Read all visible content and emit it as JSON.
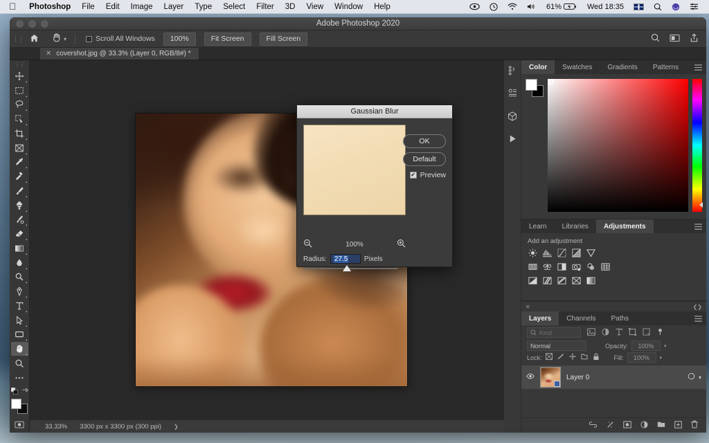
{
  "menubar": {
    "apple_icon": "apple-icon",
    "items": [
      {
        "label": "Photoshop",
        "bold": true
      },
      {
        "label": "File",
        "bold": false
      },
      {
        "label": "Edit",
        "bold": false
      },
      {
        "label": "Image",
        "bold": false
      },
      {
        "label": "Layer",
        "bold": false
      },
      {
        "label": "Type",
        "bold": false
      },
      {
        "label": "Select",
        "bold": false
      },
      {
        "label": "Filter",
        "bold": false
      },
      {
        "label": "3D",
        "bold": false
      },
      {
        "label": "View",
        "bold": false
      },
      {
        "label": "Window",
        "bold": false
      },
      {
        "label": "Help",
        "bold": false
      }
    ],
    "status": {
      "creative_cloud_icon": "creative-cloud-icon",
      "time_machine_icon": "clock-icon",
      "wifi_icon": "wifi-icon",
      "volume_icon": "speaker-icon",
      "battery_percent": "61%",
      "battery_icon": "battery-charging-icon",
      "datetime": "Wed 18:35",
      "input_flag": "uk-flag-icon",
      "spotlight_icon": "search-icon",
      "siri_icon": "siri-icon",
      "control_center_icon": "control-center-icon"
    }
  },
  "window": {
    "title": "Adobe Photoshop 2020"
  },
  "options_bar": {
    "home_icon": "home-icon",
    "tool_icon": "hand-tool-icon",
    "tool_caret": "chevron-down-icon",
    "scroll_all_windows": "Scroll All Windows",
    "buttons": [
      "100%",
      "Fit Screen",
      "Fill Screen"
    ],
    "right_icons": [
      "search-icon",
      "workspace-icon",
      "share-icon"
    ]
  },
  "document_tab": {
    "close_icon": "close-icon",
    "label": "covershot.jpg @ 33.3% (Layer 0, RGB/8#) *"
  },
  "toolbar": {
    "grip_icon": "grip-icon",
    "tools": [
      {
        "name": "move-tool",
        "active": false
      },
      {
        "name": "rectangular-marquee-tool",
        "active": false
      },
      {
        "name": "lasso-tool",
        "active": false
      },
      {
        "name": "quick-selection-tool",
        "active": false
      },
      {
        "name": "crop-tool",
        "active": false
      },
      {
        "name": "frame-tool",
        "active": false
      },
      {
        "name": "eyedropper-tool",
        "active": false
      },
      {
        "name": "spot-healing-brush-tool",
        "active": false
      },
      {
        "name": "brush-tool",
        "active": false
      },
      {
        "name": "clone-stamp-tool",
        "active": false
      },
      {
        "name": "history-brush-tool",
        "active": false
      },
      {
        "name": "eraser-tool",
        "active": false
      },
      {
        "name": "gradient-tool",
        "active": false
      },
      {
        "name": "blur-tool",
        "active": false
      },
      {
        "name": "dodge-tool",
        "active": false
      },
      {
        "name": "pen-tool",
        "active": false
      },
      {
        "name": "type-tool",
        "active": false
      },
      {
        "name": "path-selection-tool",
        "active": false
      },
      {
        "name": "rectangle-tool",
        "active": false
      },
      {
        "name": "hand-tool",
        "active": true
      },
      {
        "name": "zoom-tool",
        "active": false
      },
      {
        "name": "edit-toolbar-tool",
        "active": false
      }
    ],
    "quickmask_icon": "quick-mask-icon",
    "screenmode_icon": "screen-mode-icon"
  },
  "canvas": {
    "zoom": "33.33%",
    "dimensions": "3300 px x 3300 px (300 ppi)",
    "status_caret": "chevron-right-icon"
  },
  "icon_dock": {
    "items": [
      "history-icon",
      "actions-icon",
      "3d-icon",
      "play-icon"
    ]
  },
  "color_panel": {
    "tabs": [
      {
        "label": "Color",
        "active": true
      },
      {
        "label": "Swatches",
        "active": false
      },
      {
        "label": "Gradients",
        "active": false
      },
      {
        "label": "Patterns",
        "active": false
      }
    ],
    "menu_icon": "panel-menu-icon",
    "foreground_color": "#ffffff",
    "background_color": "#000000"
  },
  "adjustments_panel": {
    "tabs": [
      {
        "label": "Learn",
        "active": false
      },
      {
        "label": "Libraries",
        "active": false
      },
      {
        "label": "Adjustments",
        "active": true
      }
    ],
    "menu_icon": "panel-menu-icon",
    "heading": "Add an adjustment",
    "rows": [
      [
        "brightness-contrast-icon",
        "levels-icon",
        "curves-icon",
        "exposure-icon",
        "vibrance-icon"
      ],
      [
        "hue-saturation-icon",
        "color-balance-icon",
        "black-white-icon",
        "photo-filter-icon",
        "channel-mixer-icon",
        "color-lookup-icon"
      ],
      [
        "invert-icon",
        "posterize-icon",
        "threshold-icon",
        "selective-color-icon",
        "gradient-map-icon"
      ]
    ]
  },
  "layers_panel": {
    "close_icon": "close-icon",
    "collapse_icon": "collapse-icon",
    "tabs": [
      {
        "label": "Layers",
        "active": true
      },
      {
        "label": "Channels",
        "active": false
      },
      {
        "label": "Paths",
        "active": false
      }
    ],
    "menu_icon": "panel-menu-icon",
    "filter_placeholder": "Kind",
    "filter_search_icon": "search-icon",
    "filter_kinds": [
      "pixel-filter-icon",
      "adjustment-filter-icon",
      "type-filter-icon",
      "shape-filter-icon",
      "smart-object-filter-icon"
    ],
    "filter_toggle_icon": "filter-toggle-icon",
    "blend_mode": "Normal",
    "opacity_label": "Opacity:",
    "opacity_value": "100%",
    "lock_label": "Lock:",
    "lock_icons": [
      "lock-transparent-icon",
      "lock-image-icon",
      "lock-position-icon",
      "lock-artboard-icon",
      "lock-all-icon"
    ],
    "fill_label": "Fill:",
    "fill_value": "100%",
    "layers": [
      {
        "visible_icon": "eye-icon",
        "name": "Layer 0",
        "smart_object_icon": "smart-object-icon",
        "expand_icon": "chevron-down-icon"
      }
    ],
    "footer_icons": [
      "link-layers-icon",
      "layer-style-icon",
      "layer-mask-icon",
      "adjustment-layer-icon",
      "new-group-icon",
      "new-layer-icon",
      "delete-layer-icon"
    ]
  },
  "gaussian_blur_dialog": {
    "title": "Gaussian Blur",
    "ok_label": "OK",
    "default_label": "Default",
    "preview_label": "Preview",
    "preview_checked": true,
    "preview_check_glyph": "✔",
    "zoom_out_icon": "zoom-out-icon",
    "zoom_level": "100%",
    "zoom_in_icon": "zoom-in-icon",
    "radius_label": "Radius:",
    "radius_value": "27.5",
    "radius_units": "Pixels",
    "slider_icon": "slider-handle-icon"
  },
  "colors": {
    "panel_bg": "#383838",
    "canvas_bg": "#292929",
    "dialog_bg": "#3b3b3b",
    "selection_blue": "#2f5a9e",
    "active_tool": "#5a5a5a"
  }
}
